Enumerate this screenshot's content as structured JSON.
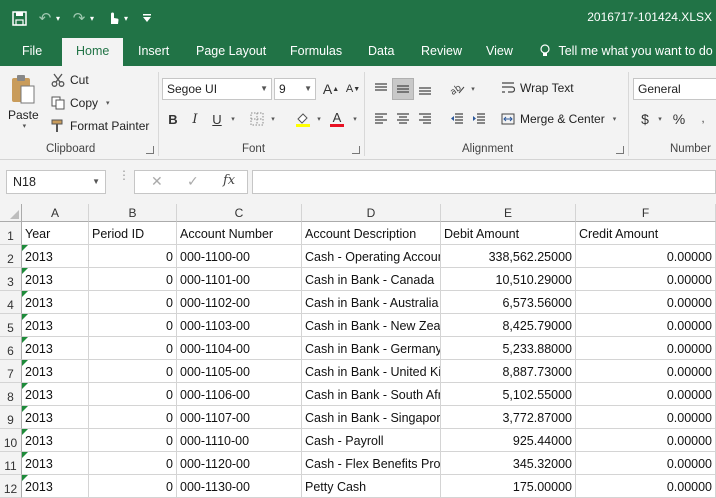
{
  "window": {
    "title": "2016717-101424.XLSX"
  },
  "qat": {
    "save": "save-icon",
    "undo": "undo-icon",
    "redo": "redo-icon",
    "touch": "touch-mode-icon",
    "customize": "customize-qat-icon"
  },
  "tabs": [
    "File",
    "Home",
    "Insert",
    "Page Layout",
    "Formulas",
    "Data",
    "Review",
    "View"
  ],
  "tell_me": "Tell me what you want to do",
  "ribbon": {
    "clipboard": {
      "label": "Clipboard",
      "paste": "Paste",
      "cut": "Cut",
      "copy": "Copy",
      "format_painter": "Format Painter"
    },
    "font": {
      "label": "Font",
      "font_name": "Segoe UI",
      "font_size": "9",
      "bold": "B",
      "italic": "I",
      "underline": "U",
      "font_color": "A"
    },
    "alignment": {
      "label": "Alignment",
      "wrap_text": "Wrap Text",
      "merge_center": "Merge & Center"
    },
    "number": {
      "label": "Number",
      "format": "General",
      "currency": "$",
      "percent": "%"
    }
  },
  "formula_bar": {
    "name_box": "N18",
    "fx": "fx",
    "cancel": "✕",
    "enter": "✓",
    "value": ""
  },
  "sheet": {
    "columns": [
      "A",
      "B",
      "C",
      "D",
      "E",
      "F"
    ],
    "row_numbers": [
      "1",
      "2",
      "3",
      "4",
      "5",
      "6",
      "7",
      "8",
      "9",
      "10",
      "11",
      "12"
    ],
    "header": [
      "Year",
      "Period ID",
      "Account Number",
      "Account Description",
      "Debit Amount",
      "Credit Amount"
    ],
    "rows": [
      [
        "2013",
        "0",
        "000-1100-00",
        "Cash - Operating Account",
        "338,562.25000",
        "0.00000"
      ],
      [
        "2013",
        "0",
        "000-1101-00",
        "Cash in Bank - Canada",
        "10,510.29000",
        "0.00000"
      ],
      [
        "2013",
        "0",
        "000-1102-00",
        "Cash in Bank - Australia",
        "6,573.56000",
        "0.00000"
      ],
      [
        "2013",
        "0",
        "000-1103-00",
        "Cash in Bank - New Zealand",
        "8,425.79000",
        "0.00000"
      ],
      [
        "2013",
        "0",
        "000-1104-00",
        "Cash in Bank - Germany",
        "5,233.88000",
        "0.00000"
      ],
      [
        "2013",
        "0",
        "000-1105-00",
        "Cash in Bank - United Kingdom",
        "8,887.73000",
        "0.00000"
      ],
      [
        "2013",
        "0",
        "000-1106-00",
        "Cash in Bank - South Africa",
        "5,102.55000",
        "0.00000"
      ],
      [
        "2013",
        "0",
        "000-1107-00",
        "Cash in Bank - Singapore",
        "3,772.87000",
        "0.00000"
      ],
      [
        "2013",
        "0",
        "000-1110-00",
        "Cash - Payroll",
        "925.44000",
        "0.00000"
      ],
      [
        "2013",
        "0",
        "000-1120-00",
        "Cash - Flex Benefits Program",
        "345.32000",
        "0.00000"
      ],
      [
        "2013",
        "0",
        "000-1130-00",
        "Petty Cash",
        "175.00000",
        "0.00000"
      ]
    ]
  },
  "colors": {
    "accent": "#217346",
    "ribbon_bg": "#f3f3f3",
    "error_triangle": "#1e8b3a"
  }
}
